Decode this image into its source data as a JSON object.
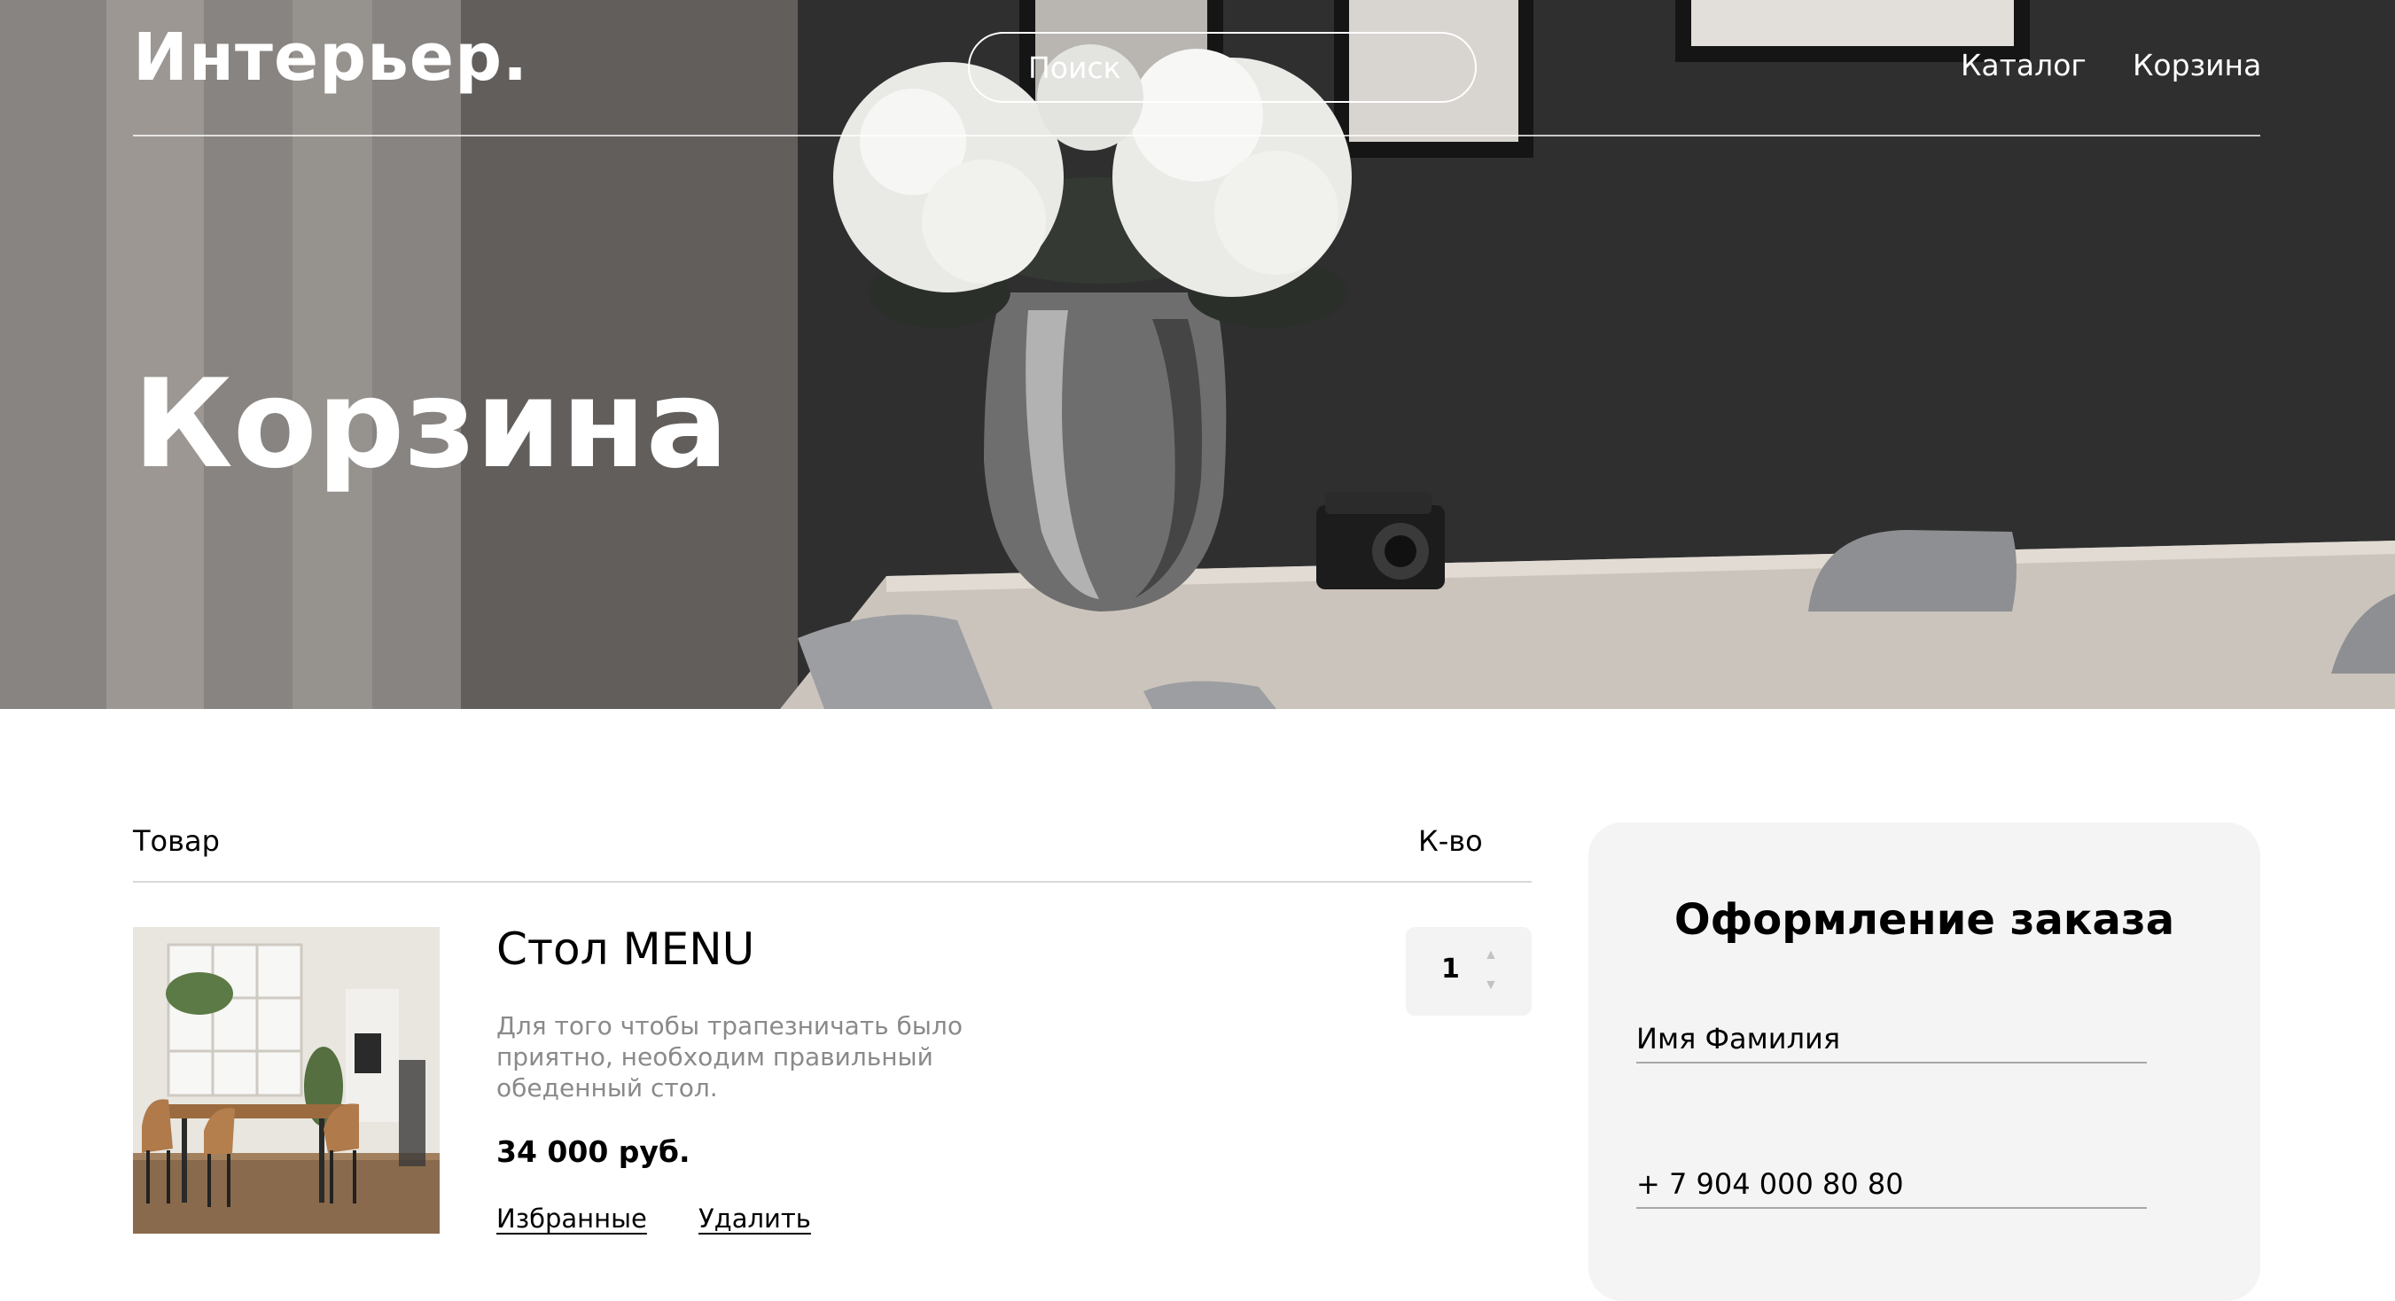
{
  "header": {
    "logo": "Интерьер.",
    "search_placeholder": "Поиск",
    "nav": {
      "catalog": "Каталог",
      "cart": "Корзина"
    }
  },
  "hero": {
    "title": "Корзина"
  },
  "cart": {
    "columns": {
      "product": "Товар",
      "quantity": "К-во"
    },
    "items": [
      {
        "name": "Стол MENU",
        "description": "Для того чтобы трапезничать было приятно, необходим правильный обеденный стол.",
        "price": "34 000 руб.",
        "quantity": "1",
        "favorite_label": "Избранные",
        "delete_label": "Удалить"
      }
    ]
  },
  "order": {
    "title": "Оформление заказа",
    "name_placeholder": "Имя Фамилия",
    "phone_placeholder": "+ 7 904 000 80 80"
  },
  "colors": {
    "panel_bg": "#f4f4f4",
    "qty_bg": "#f3f3f3",
    "muted_text": "#8a8a8a"
  }
}
